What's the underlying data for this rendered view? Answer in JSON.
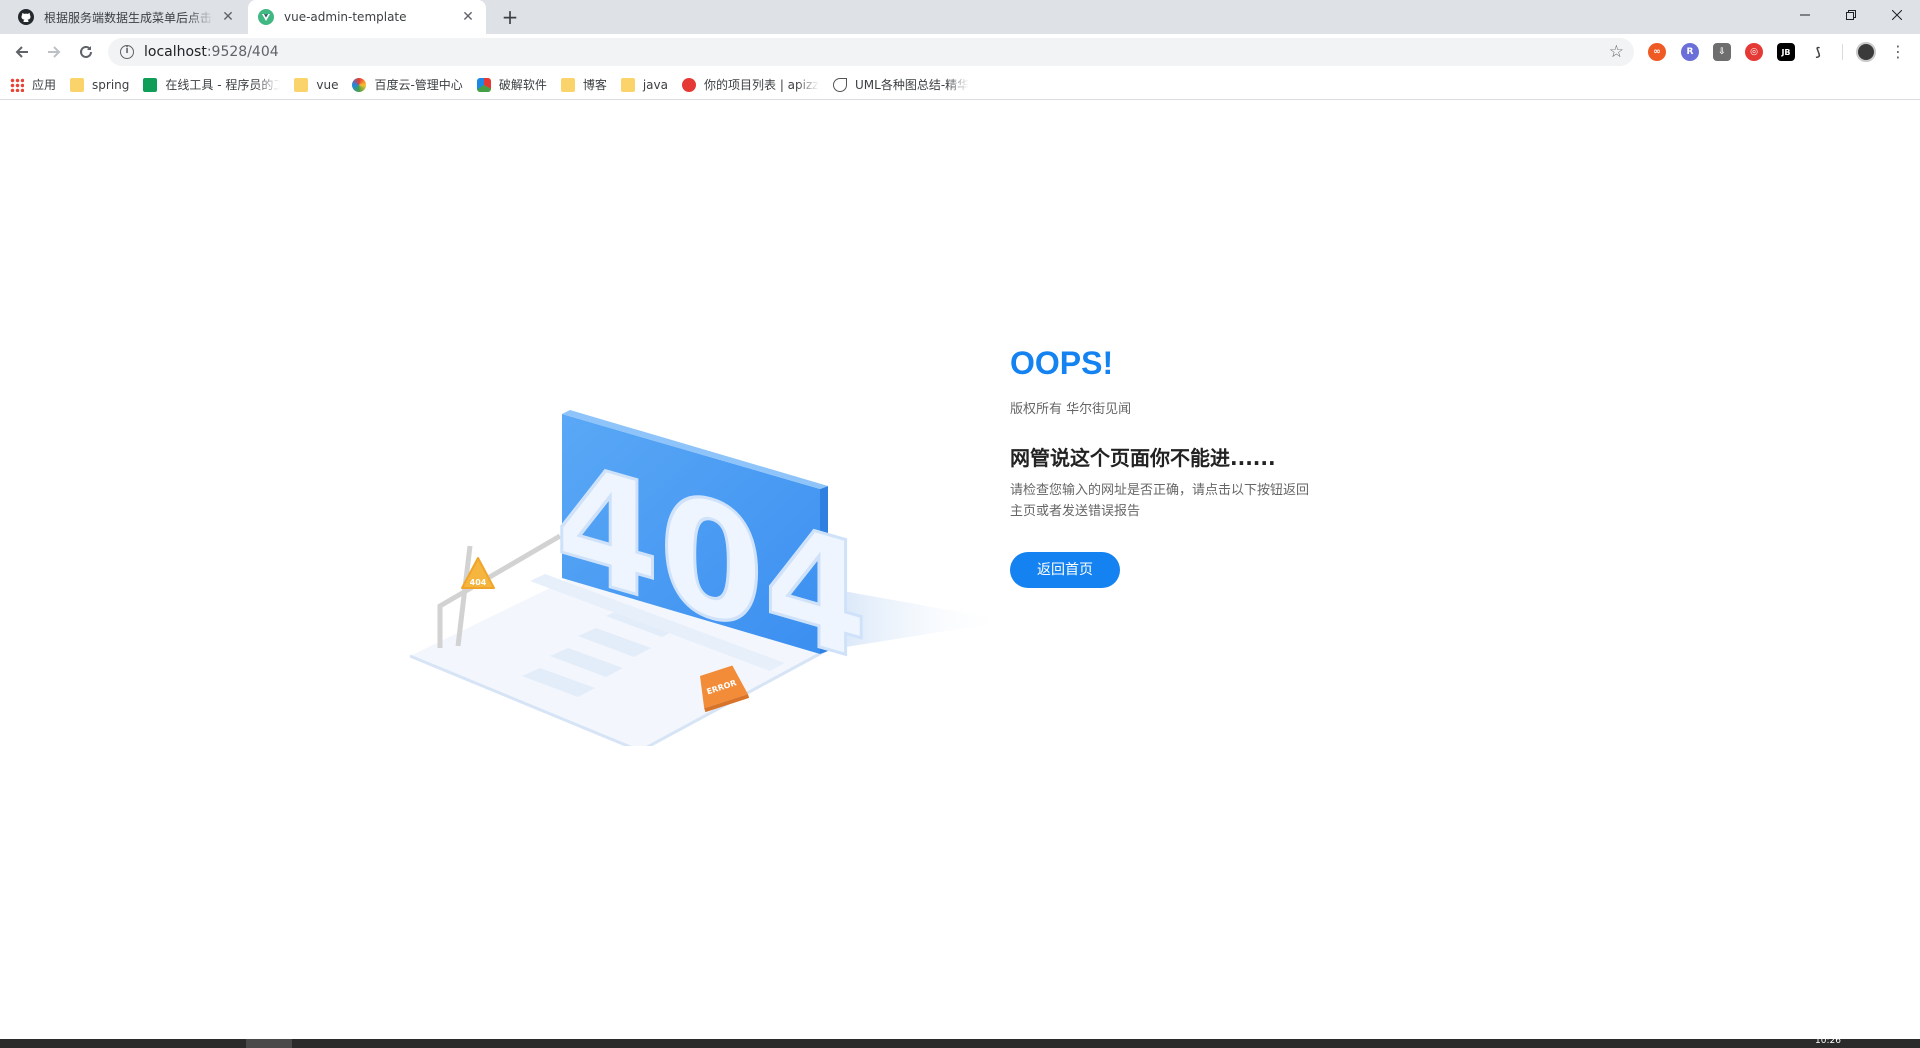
{
  "browser": {
    "tabs": [
      {
        "title": "根据服务端数据生成菜单后点击",
        "icon": "github-icon",
        "active": false
      },
      {
        "title": "vue-admin-template",
        "icon": "vue-icon",
        "active": true
      }
    ],
    "new_tab_label": "+",
    "address": {
      "host": "localhost",
      "path": ":9528/404"
    },
    "extensions": [
      "∞",
      "R",
      "⇩",
      "◎",
      "JB",
      "⟆"
    ]
  },
  "bookmarks": [
    {
      "label": "应用",
      "icon": "apps-icon"
    },
    {
      "label": "spring",
      "icon": "folder-icon"
    },
    {
      "label": "在线工具 - 程序员的工具箱",
      "icon": "tool-icon"
    },
    {
      "label": "vue",
      "icon": "folder-icon"
    },
    {
      "label": "百度云-管理中心",
      "icon": "baidu-icon"
    },
    {
      "label": "破解软件",
      "icon": "crack-icon"
    },
    {
      "label": "博客",
      "icon": "folder-icon"
    },
    {
      "label": "java",
      "icon": "folder-icon"
    },
    {
      "label": "你的项目列表 | apizza",
      "icon": "apizza-icon"
    },
    {
      "label": "UML各种图总结-精华",
      "icon": "uml-icon"
    }
  ],
  "page": {
    "illustration": {
      "big_number": "404",
      "sign_text": "404",
      "cone_text": "ERROR",
      "colors": {
        "panel": "#4a9cf2",
        "panel_side": "#2f80e0",
        "floor": "#eef4fc"
      }
    },
    "oops": "OOPS!",
    "copyright": "版权所有 华尔街见闻",
    "headline": "网管说这个页面你不能进......",
    "info": "请检查您输入的网址是否正确，请点击以下按钮返回主页或者发送错误报告",
    "home_button": "返回首页",
    "accent_color": "#1482f0"
  },
  "taskbar": {
    "clock": "10:26"
  }
}
